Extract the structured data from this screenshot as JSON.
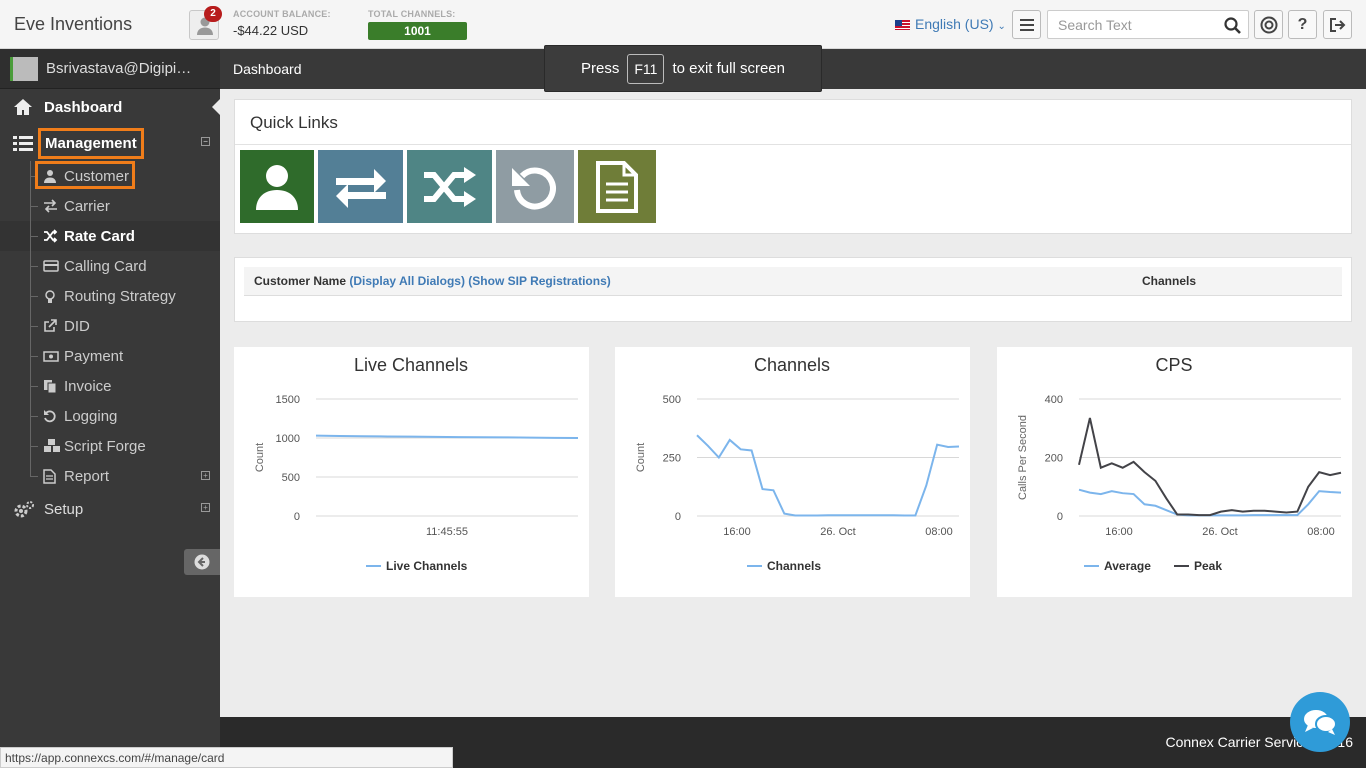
{
  "app": {
    "title": "Eve Inventions",
    "notifications": "2"
  },
  "account": {
    "balance_label": "ACCOUNT BALANCE:",
    "balance_value": "-$44.22 USD",
    "channels_label": "TOTAL CHANNELS:",
    "channels_value": "1001"
  },
  "toolbar": {
    "language": "English (US)",
    "search_placeholder": "Search Text"
  },
  "sidebar": {
    "user": "Bsrivastava@Digipig...",
    "dashboard": "Dashboard",
    "management": "Management",
    "items": [
      {
        "label": "Customer",
        "icon": "user-icon"
      },
      {
        "label": "Carrier",
        "icon": "exchange-icon"
      },
      {
        "label": "Rate Card",
        "icon": "shuffle-icon"
      },
      {
        "label": "Calling Card",
        "icon": "credit-card-icon"
      },
      {
        "label": "Routing Strategy",
        "icon": "lightbulb-icon"
      },
      {
        "label": "DID",
        "icon": "external-link-icon"
      },
      {
        "label": "Payment",
        "icon": "money-icon"
      },
      {
        "label": "Invoice",
        "icon": "files-icon"
      },
      {
        "label": "Logging",
        "icon": "undo-icon"
      },
      {
        "label": "Script Forge",
        "icon": "cubes-icon"
      },
      {
        "label": "Report",
        "icon": "file-icon"
      }
    ],
    "setup": "Setup"
  },
  "breadcrumb": "Dashboard",
  "fullscreen_notice": {
    "press": "Press",
    "key": "F11",
    "rest": "to exit full screen"
  },
  "quick_links": {
    "title": "Quick Links",
    "colors": [
      "#2f6b2b",
      "#537f96",
      "#4f8585",
      "#8f9ca3",
      "#6f7d38"
    ]
  },
  "table": {
    "customer_name": "Customer Name",
    "display_dialogs": "(Display All Dialogs)",
    "show_sip": "(Show SIP Registrations)",
    "channels": "Channels"
  },
  "chart_data": [
    {
      "type": "line",
      "title": "Live Channels",
      "ylabel": "Count",
      "ylim": [
        0,
        1500
      ],
      "yticks": [
        0,
        500,
        1000,
        1500
      ],
      "xticks": [
        "11:45:55"
      ],
      "series": [
        {
          "name": "Live Channels",
          "color": "#7cb5ec",
          "values": [
            1030,
            1025,
            1022,
            1020,
            1018,
            1015,
            1012,
            1010,
            1008,
            1005,
            1002,
            1000
          ]
        }
      ]
    },
    {
      "type": "line",
      "title": "Channels",
      "ylabel": "Count",
      "ylim": [
        0,
        500
      ],
      "yticks": [
        0,
        250,
        500
      ],
      "xticks": [
        "16:00",
        "26. Oct",
        "08:00"
      ],
      "series": [
        {
          "name": "Channels",
          "color": "#7cb5ec",
          "values": [
            345,
            300,
            250,
            325,
            285,
            280,
            115,
            110,
            10,
            2,
            2,
            2,
            3,
            3,
            3,
            3,
            3,
            3,
            3,
            2,
            2,
            130,
            305,
            295,
            297
          ]
        }
      ]
    },
    {
      "type": "line",
      "title": "CPS",
      "ylabel": "Calls Per Second",
      "ylim": [
        0,
        400
      ],
      "yticks": [
        0,
        200,
        400
      ],
      "xticks": [
        "16:00",
        "26. Oct",
        "08:00"
      ],
      "series": [
        {
          "name": "Average",
          "color": "#7cb5ec",
          "values": [
            90,
            80,
            75,
            85,
            78,
            75,
            40,
            35,
            20,
            5,
            2,
            2,
            2,
            2,
            2,
            2,
            3,
            3,
            3,
            3,
            3,
            40,
            85,
            82,
            80
          ]
        },
        {
          "name": "Peak",
          "color": "#434348",
          "values": [
            175,
            335,
            165,
            180,
            165,
            185,
            150,
            120,
            60,
            5,
            5,
            3,
            3,
            15,
            20,
            15,
            18,
            18,
            15,
            12,
            15,
            100,
            150,
            140,
            148
          ]
        }
      ]
    }
  ],
  "footer": "Connex Carrier Services 2016",
  "status_url": "https://app.connexcs.com/#/manage/card"
}
